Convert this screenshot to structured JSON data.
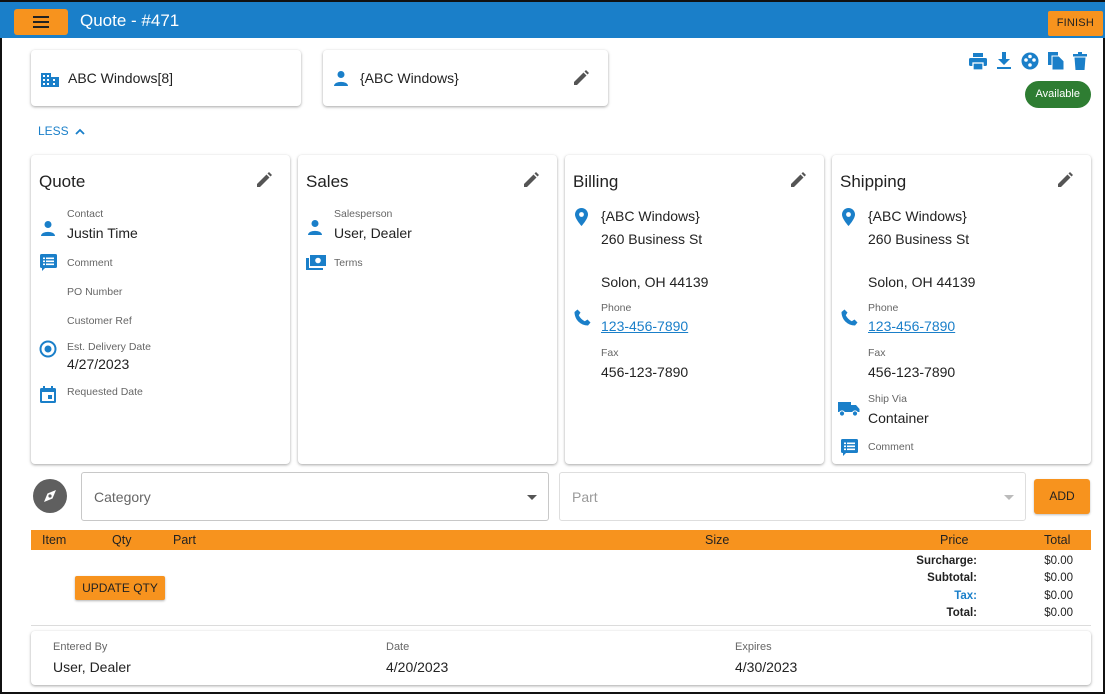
{
  "header": {
    "title": "Quote - #471",
    "finish_label": "FINISH"
  },
  "customer": {
    "name": "ABC Windows[8]",
    "contact_name": "{ABC Windows}"
  },
  "status_badge": "Available",
  "toggle_label": "LESS",
  "quote": {
    "title": "Quote",
    "contact_label": "Contact",
    "contact_value": "Justin Time",
    "comment_label": "Comment",
    "po_label": "PO Number",
    "custref_label": "Customer Ref",
    "est_delivery_label": "Est. Delivery Date",
    "est_delivery_value": "4/27/2023",
    "requested_label": "Requested Date"
  },
  "sales": {
    "title": "Sales",
    "salesperson_label": "Salesperson",
    "salesperson_value": "User, Dealer",
    "terms_label": "Terms"
  },
  "billing": {
    "title": "Billing",
    "name": "{ABC Windows}",
    "street": "260 Business St",
    "city": "Solon, OH 44139",
    "phone_label": "Phone",
    "phone": "123-456-7890",
    "fax_label": "Fax",
    "fax": "456-123-7890"
  },
  "shipping": {
    "title": "Shipping",
    "name": "{ABC Windows}",
    "street": "260 Business St",
    "city": "Solon, OH 44139",
    "phone_label": "Phone",
    "phone": "123-456-7890",
    "fax_label": "Fax",
    "fax": "456-123-7890",
    "shipvia_label": "Ship Via",
    "shipvia_value": "Container",
    "comment_label": "Comment"
  },
  "add_row": {
    "category_placeholder": "Category",
    "part_placeholder": "Part",
    "add_label": "ADD"
  },
  "table": {
    "columns": [
      "Item",
      "Qty",
      "Part",
      "Size",
      "Price",
      "Total"
    ]
  },
  "update_qty_label": "UPDATE QTY",
  "totals": [
    {
      "label": "Surcharge:",
      "value": "$0.00"
    },
    {
      "label": "Subtotal:",
      "value": "$0.00"
    },
    {
      "label": "Tax:",
      "value": "$0.00"
    },
    {
      "label": "Total:",
      "value": "$0.00"
    }
  ],
  "footer": {
    "entered_by_label": "Entered By",
    "entered_by": "User, Dealer",
    "date_label": "Date",
    "date": "4/20/2023",
    "expires_label": "Expires",
    "expires": "4/30/2023"
  },
  "icons": {
    "building": "building-icon",
    "person": "person-icon",
    "edit": "pencil-icon",
    "print": "print-icon",
    "download": "download-icon",
    "palette": "palette-icon",
    "copy": "copy-icon",
    "delete": "trash-icon",
    "place": "location-pin-icon",
    "phone": "phone-icon",
    "fax": "fax-icon",
    "comment": "comment-icon",
    "event": "calendar-icon",
    "truck": "truck-icon",
    "compass": "compass-icon"
  },
  "colors": {
    "appbar": "#1a7fc9",
    "accent": "#f7931e",
    "badge": "#2e7d32",
    "link": "#1a7fc9"
  }
}
